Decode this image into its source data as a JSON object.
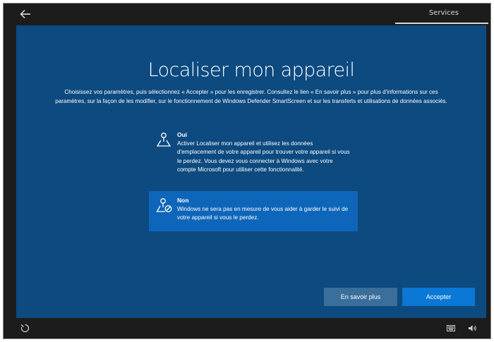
{
  "topbar": {
    "section_label": "Services",
    "back_icon": "back-arrow-icon"
  },
  "main": {
    "title": "Localiser mon appareil",
    "description": "Choisissez vos paramètres, puis sélectionnez « Accepter » pour les enregistrer. Consultez le lien « En savoir plus » pour plus d'informations sur ces paramètres, sur la façon de les modifier, sur le fonctionnement de Windows Defender SmartScreen et sur les transferts et utilisations de données associés.",
    "options": [
      {
        "title": "Oui",
        "body": "Activer Localiser mon appareil et utilisez les données d'emplacement de votre appareil pour trouver votre appareil si vous le perdez. Vous devez vous connecter à Windows avec votre compte Microsoft pour utiliser cette fonctionnalité.",
        "icon": "location-pin-icon",
        "selected": false
      },
      {
        "title": "Non",
        "body": "Windows ne sera pas en mesure de vous aider à garder le suivi de votre appareil si vous le perdez.",
        "icon": "location-off-icon",
        "selected": true
      }
    ],
    "buttons": {
      "learn_more": "En savoir plus",
      "accept": "Accepter"
    }
  },
  "bottombar": {
    "icons": [
      "ease-of-access-icon",
      "keyboard-icon",
      "volume-icon"
    ]
  },
  "colors": {
    "panel_bg": "#0c4a80",
    "selected_option_bg": "#0e66ba",
    "accept_button": "#0a78d4",
    "learn_more_button": "#3a6e9b",
    "frame_bg": "#1c1c1c"
  }
}
